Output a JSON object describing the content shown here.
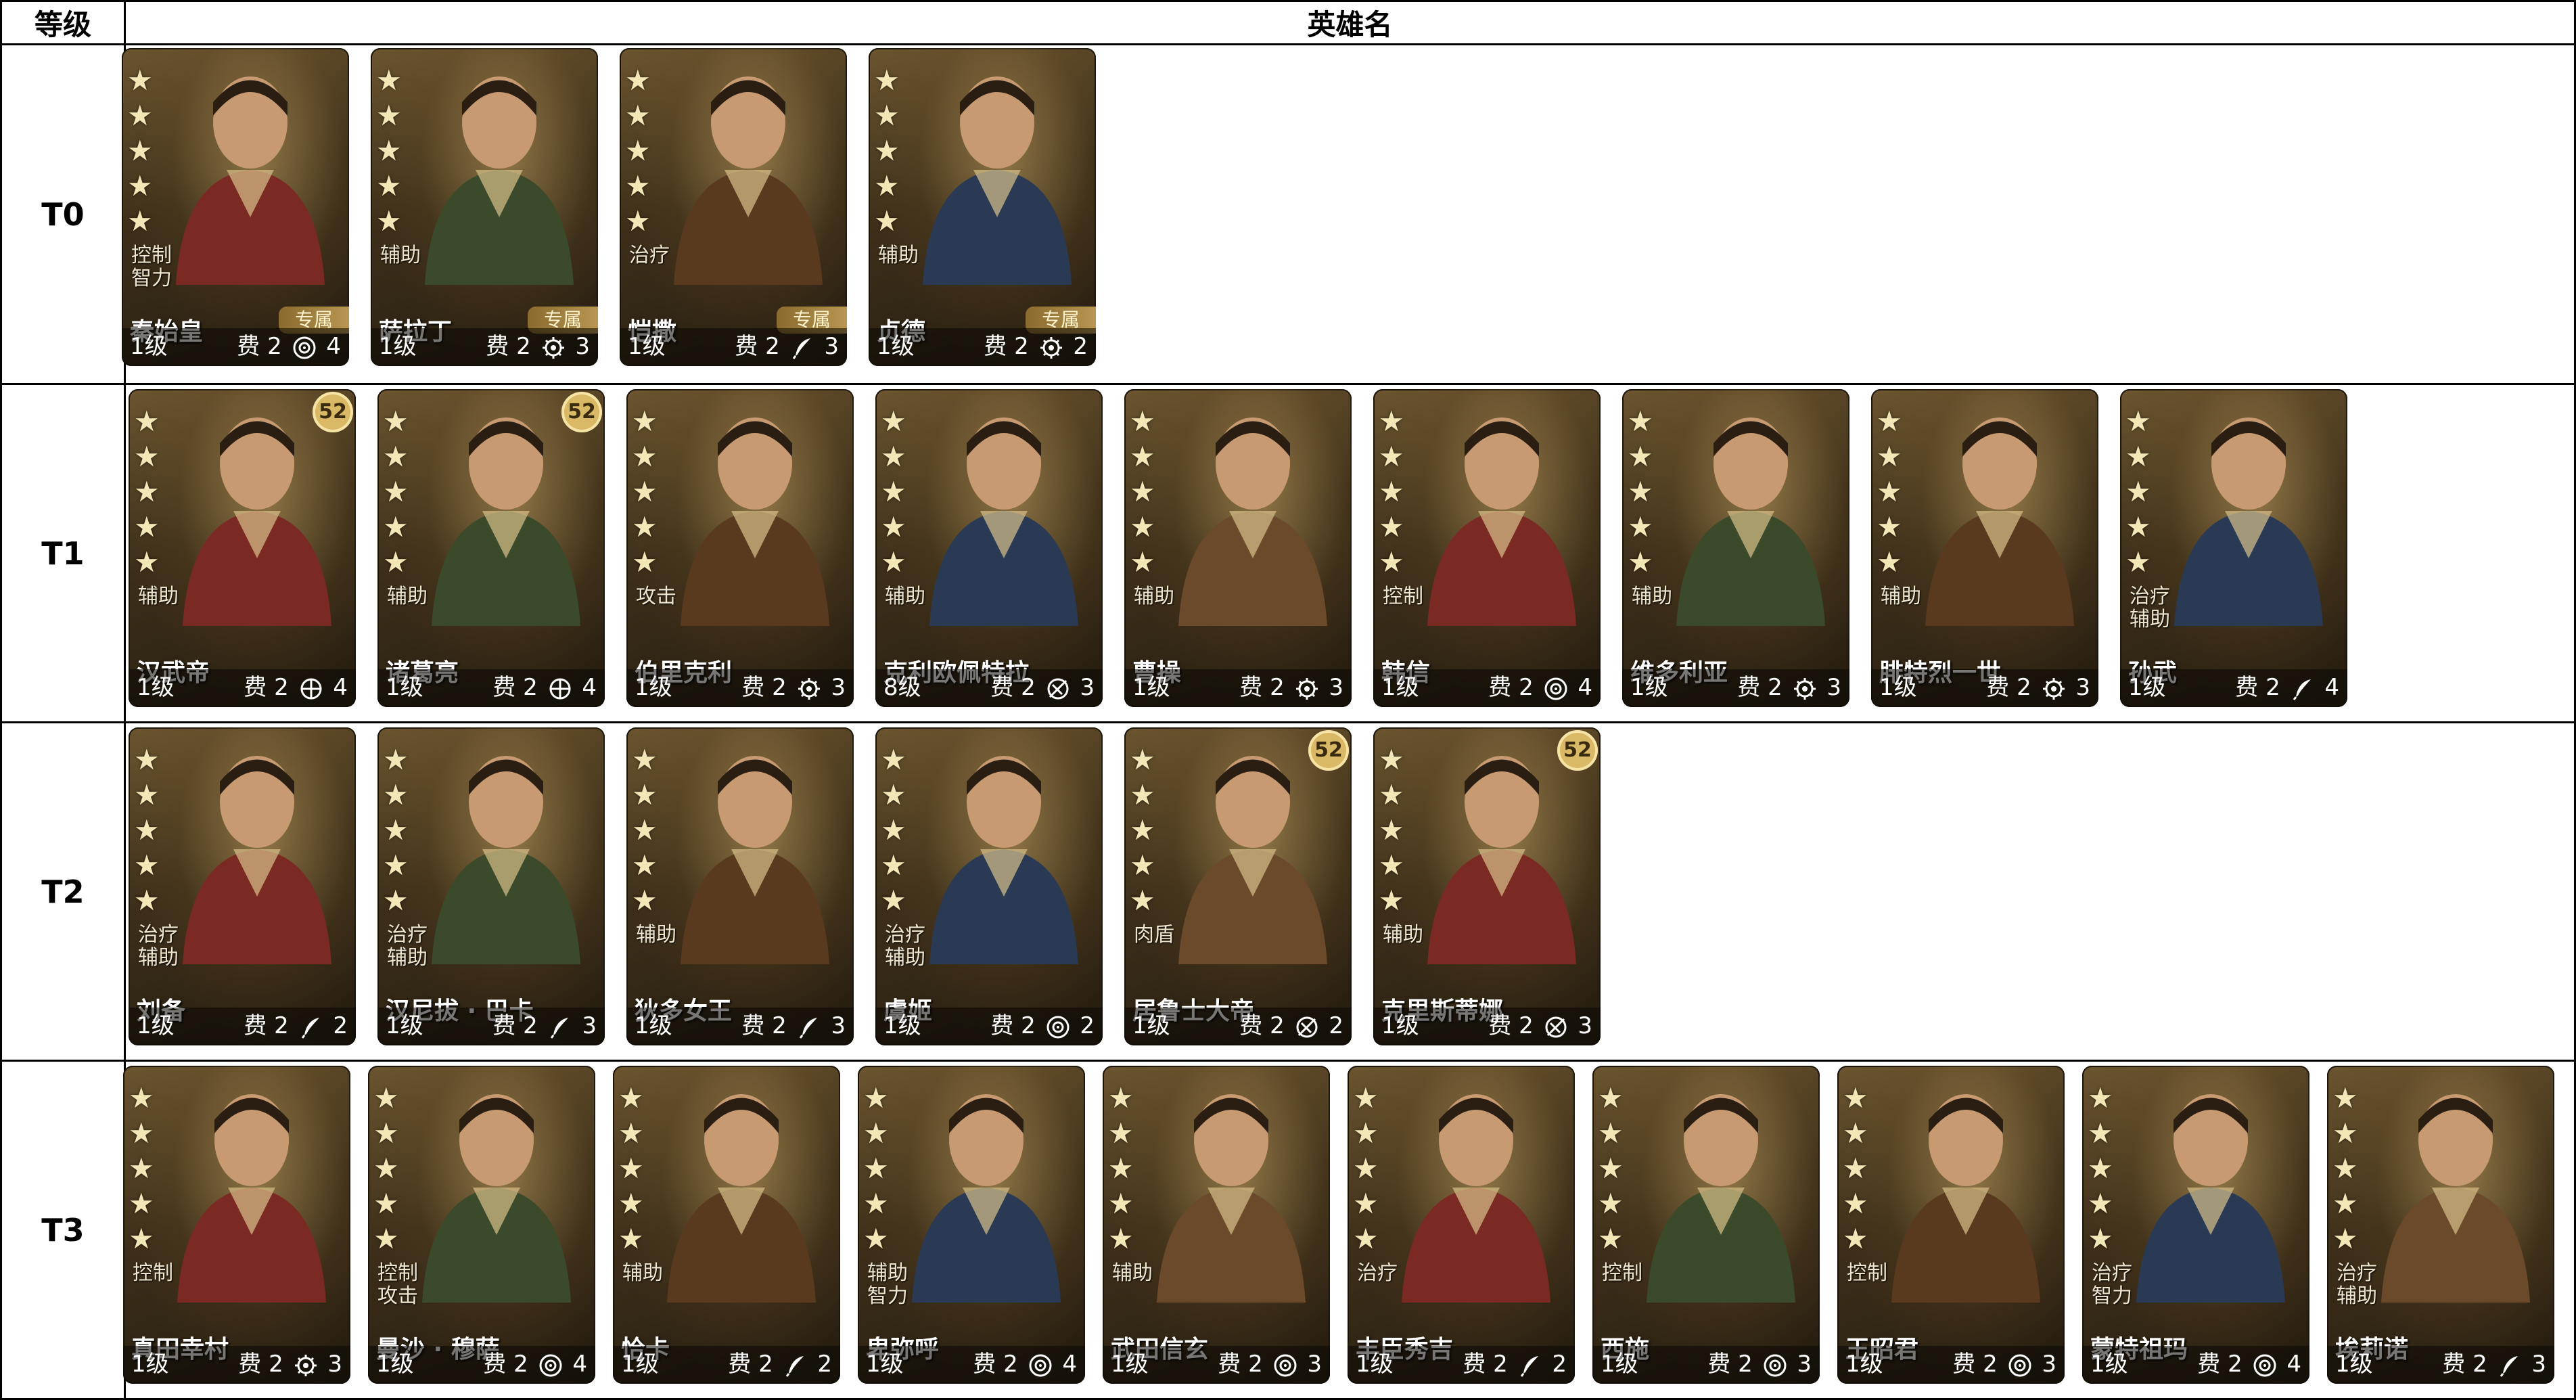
{
  "header": {
    "tier_col": "等级",
    "name_col": "英雄名"
  },
  "cost_prefix": "费",
  "exclusive_label": "专属",
  "badge_52": "52",
  "tiers": [
    {
      "label": "T0",
      "heroes": [
        {
          "roles": [
            "控制",
            "智力"
          ],
          "name": "秦始皇",
          "level": "1级",
          "cost": "2",
          "cost_icon": "target-icon",
          "count": "4",
          "exclusive": true
        },
        {
          "roles": [
            "辅助"
          ],
          "name": "萨拉丁",
          "level": "1级",
          "cost": "2",
          "cost_icon": "gear-icon",
          "count": "3",
          "exclusive": true
        },
        {
          "roles": [
            "治疗"
          ],
          "name": "恺撒",
          "level": "1级",
          "cost": "2",
          "cost_icon": "feather-icon",
          "count": "3",
          "exclusive": true
        },
        {
          "roles": [
            "辅助"
          ],
          "name": "贞德",
          "level": "1级",
          "cost": "2",
          "cost_icon": "gear-icon",
          "count": "2",
          "exclusive": true
        }
      ]
    },
    {
      "label": "T1",
      "heroes": [
        {
          "roles": [
            "辅助"
          ],
          "name": "汉武帝",
          "level": "1级",
          "cost": "2",
          "cost_icon": "shield-icon",
          "count": "4",
          "badge": true
        },
        {
          "roles": [
            "辅助"
          ],
          "name": "诸葛亮",
          "level": "1级",
          "cost": "2",
          "cost_icon": "shield-icon",
          "count": "4",
          "badge": true
        },
        {
          "roles": [
            "攻击"
          ],
          "name": "伯里克利",
          "level": "1级",
          "cost": "2",
          "cost_icon": "gear-icon",
          "count": "3"
        },
        {
          "roles": [
            "辅助"
          ],
          "name": "克利欧佩特拉",
          "level": "8级",
          "cost": "2",
          "cost_icon": "slash-icon",
          "count": "3"
        },
        {
          "roles": [
            "辅助"
          ],
          "name": "曹操",
          "level": "1级",
          "cost": "2",
          "cost_icon": "gear-icon",
          "count": "3"
        },
        {
          "roles": [
            "控制"
          ],
          "name": "韩信",
          "level": "1级",
          "cost": "2",
          "cost_icon": "target-icon",
          "count": "4"
        },
        {
          "roles": [
            "辅助"
          ],
          "name": "维多利亚",
          "level": "1级",
          "cost": "2",
          "cost_icon": "gear-icon",
          "count": "3"
        },
        {
          "roles": [
            "辅助"
          ],
          "name": "腓特烈一世",
          "level": "1级",
          "cost": "2",
          "cost_icon": "gear-icon",
          "count": "3"
        },
        {
          "roles": [
            "治疗",
            "辅助"
          ],
          "name": "孙武",
          "level": "1级",
          "cost": "2",
          "cost_icon": "feather-icon",
          "count": "4"
        }
      ]
    },
    {
      "label": "T2",
      "heroes": [
        {
          "roles": [
            "治疗",
            "辅助"
          ],
          "name": "刘备",
          "level": "1级",
          "cost": "2",
          "cost_icon": "feather-icon",
          "count": "2"
        },
        {
          "roles": [
            "治疗",
            "辅助"
          ],
          "name": "汉尼拔 · 巴卡",
          "level": "1级",
          "cost": "2",
          "cost_icon": "feather-icon",
          "count": "3"
        },
        {
          "roles": [
            "辅助"
          ],
          "name": "狄多女王",
          "level": "1级",
          "cost": "2",
          "cost_icon": "feather-icon",
          "count": "3"
        },
        {
          "roles": [
            "治疗",
            "辅助"
          ],
          "name": "虞姬",
          "level": "1级",
          "cost": "2",
          "cost_icon": "target-icon",
          "count": "2"
        },
        {
          "roles": [
            "肉盾"
          ],
          "name": "居鲁士大帝",
          "level": "1级",
          "cost": "2",
          "cost_icon": "slash-icon",
          "count": "2",
          "badge": true
        },
        {
          "roles": [
            "辅助"
          ],
          "name": "克里斯蒂娜",
          "level": "1级",
          "cost": "2",
          "cost_icon": "slash-icon",
          "count": "3",
          "badge": true
        }
      ]
    },
    {
      "label": "T3",
      "heroes": [
        {
          "roles": [
            "控制"
          ],
          "name": "真田幸村",
          "level": "1级",
          "cost": "2",
          "cost_icon": "gear-icon",
          "count": "3"
        },
        {
          "roles": [
            "控制",
            "攻击"
          ],
          "name": "曼沙 · 穆萨",
          "level": "1级",
          "cost": "2",
          "cost_icon": "target-icon",
          "count": "4"
        },
        {
          "roles": [
            "辅助"
          ],
          "name": "恰卡",
          "level": "1级",
          "cost": "2",
          "cost_icon": "feather-icon",
          "count": "2"
        },
        {
          "roles": [
            "辅助",
            "智力"
          ],
          "name": "卑弥呼",
          "level": "1级",
          "cost": "2",
          "cost_icon": "target-icon",
          "count": "4"
        },
        {
          "roles": [
            "辅助"
          ],
          "name": "武田信玄",
          "level": "1级",
          "cost": "2",
          "cost_icon": "target-icon",
          "count": "3"
        },
        {
          "roles": [
            "治疗"
          ],
          "name": "丰臣秀吉",
          "level": "1级",
          "cost": "2",
          "cost_icon": "feather-icon",
          "count": "2"
        },
        {
          "roles": [
            "控制"
          ],
          "name": "西施",
          "level": "1级",
          "cost": "2",
          "cost_icon": "target-icon",
          "count": "3"
        },
        {
          "roles": [
            "控制"
          ],
          "name": "王昭君",
          "level": "1级",
          "cost": "2",
          "cost_icon": "target-icon",
          "count": "3"
        },
        {
          "roles": [
            "治疗",
            "智力"
          ],
          "name": "蒙特祖玛",
          "level": "1级",
          "cost": "2",
          "cost_icon": "target-icon",
          "count": "4"
        },
        {
          "roles": [
            "治疗",
            "辅助"
          ],
          "name": "埃莉诺",
          "level": "1级",
          "cost": "2",
          "cost_icon": "feather-icon",
          "count": "3"
        }
      ]
    }
  ]
}
